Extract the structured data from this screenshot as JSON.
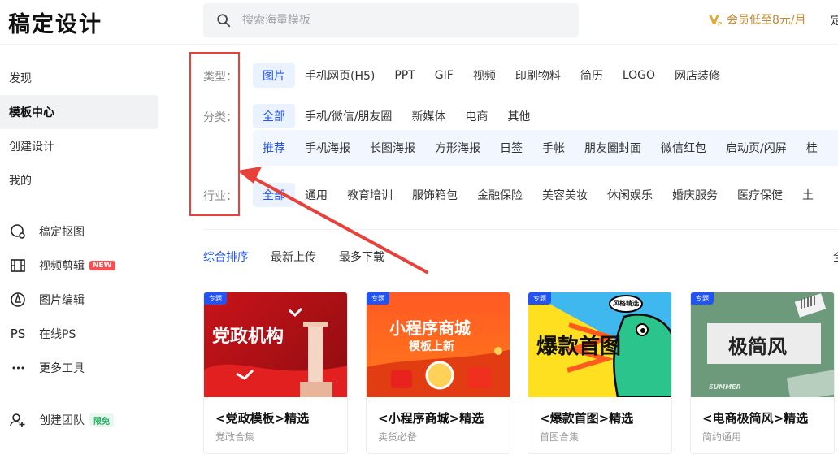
{
  "header": {
    "logo": "稿定设计",
    "search_placeholder": "搜索海量模板",
    "vip_text": "会员低至8元/月",
    "more_text": "定"
  },
  "sidebar": {
    "nav": [
      {
        "label": "发现"
      },
      {
        "label": "模板中心"
      },
      {
        "label": "创建设计"
      },
      {
        "label": "我的"
      }
    ],
    "tools": [
      {
        "label": "稿定抠图",
        "icon": "cutout-icon"
      },
      {
        "label": "视频剪辑",
        "icon": "film-icon",
        "badge": "NEW"
      },
      {
        "label": "图片编辑",
        "icon": "pen-icon"
      },
      {
        "label": "在线PS",
        "icon": "ps-icon",
        "icon_text": "PS"
      },
      {
        "label": "更多工具",
        "icon": "more-icon",
        "icon_text": "•••"
      }
    ],
    "team": {
      "label": "创建团队",
      "badge": "限免"
    }
  },
  "filters": {
    "type_label": "类型：",
    "type_items": [
      "图片",
      "手机网页(H5)",
      "PPT",
      "GIF",
      "视频",
      "印刷物料",
      "简历",
      "LOGO",
      "网店装修"
    ],
    "category_label": "分类：",
    "category_items": [
      "全部",
      "手机/微信/朋友圈",
      "新媒体",
      "电商",
      "其他"
    ],
    "sub_items": [
      "推荐",
      "手机海报",
      "长图海报",
      "方形海报",
      "日签",
      "手帐",
      "朋友圈封面",
      "微信红包",
      "启动页/闪屏",
      "桂"
    ],
    "industry_label": "行业：",
    "industry_items": [
      "全部",
      "通用",
      "教育培训",
      "服饰箱包",
      "金融保险",
      "美容美妆",
      "休闲娱乐",
      "婚庆服务",
      "医疗保健",
      "土"
    ]
  },
  "sort": {
    "items": [
      "综合排序",
      "最新上传",
      "最多下载"
    ],
    "right": "全"
  },
  "cards": [
    {
      "tag": "专题",
      "art_text": "党政机构",
      "title": "<党政模板>精选",
      "subtitle": "党政合集"
    },
    {
      "tag": "专题",
      "art_text": "小程序商城",
      "art_sub": "模板上新",
      "title": "<小程序商城>精选",
      "subtitle": "卖货必备"
    },
    {
      "tag": "专题",
      "art_text": "爆款首图",
      "art_sub": "风格精选",
      "title": "<爆款首图>精选",
      "subtitle": "首图合集"
    },
    {
      "tag": "专题",
      "art_text": "极简风",
      "art_sub": "SUMMER",
      "title": "<电商极简风>精选",
      "subtitle": "简约通用"
    }
  ],
  "colors": {
    "accent": "#2254f4",
    "annotation": "#e8413a",
    "vip": "#c68a2e"
  }
}
